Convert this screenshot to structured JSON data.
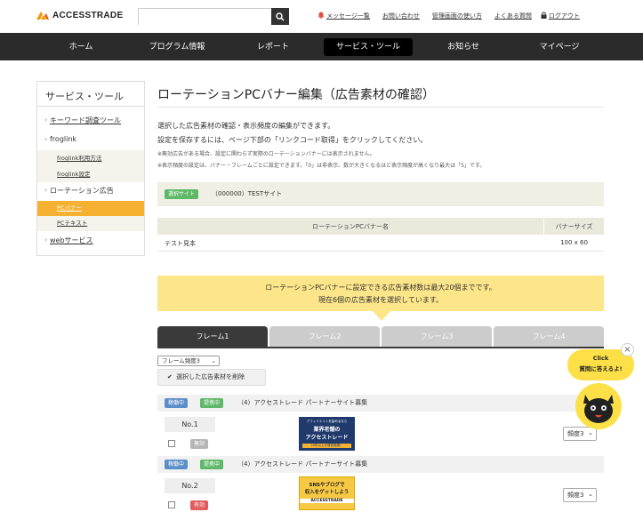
{
  "header": {
    "logo_text": "ACCESSTRADE",
    "search_placeholder": "",
    "links": [
      "メッセージ一覧",
      "お問い合わせ",
      "管理画面の使い方",
      "よくある質問",
      "ログアウト"
    ]
  },
  "nav": {
    "items": [
      "ホーム",
      "プログラム情報",
      "レポート",
      "サービス・ツール",
      "お知らせ",
      "マイページ"
    ],
    "active_index": 3
  },
  "sidebar": {
    "title": "サービス・ツール",
    "items": [
      {
        "label": "キーワード調査ツール"
      },
      {
        "label": "froglink"
      },
      {
        "label": "froglink利用方法"
      },
      {
        "label": "froglink設定"
      },
      {
        "label": "ローテーション広告"
      },
      {
        "label": "PCバナー"
      },
      {
        "label": "PCテキスト"
      },
      {
        "label": "webサービス"
      }
    ]
  },
  "main": {
    "title": "ローテーションPCバナー編集（広告素材の確認）",
    "desc1": "選択した広告素材の確認・表示頻度の編集ができます。",
    "desc2": "設定を保存するには、ページ下部の「リンクコード取得」をクリックしてください。",
    "note1": "※無効広告がある場合、設定に関わらず実際のローテーションバナーには表示されません。",
    "note2": "※表示頻度の設定は、バナー・フレームごとに設定できます。「0」は非表示、数が大きくなるほど表示頻度が高くなり最大は「5」です。",
    "site_tag": "選択サイト",
    "site_name": "（000000）TESTサイト",
    "table_header_name": "ローテーションPCバナー名",
    "table_header_size": "バナーサイズ",
    "table_row_name": "テスト見本",
    "table_row_size": "100 x 60",
    "notice_line1": "ローテーションPCバナーに設定できる広告素材数は最大20個までです。",
    "notice_line2": "現在6個の広告素材を選択しています。",
    "tabs": [
      "フレーム1",
      "フレーム2",
      "フレーム3",
      "フレーム4"
    ],
    "frame_select": "フレーム頻度3",
    "delete_button": "選択した広告素材を削除"
  },
  "items": [
    {
      "status1": "稼働中",
      "status2": "提携中",
      "program": "（4）アクセストレード パートナーサイト募集",
      "number": "No.1",
      "validity": "無効",
      "banner_text": [
        "アフィリエイトを始めるなら",
        "業界老舗の",
        "アクセストレード",
        "20年以上の運営実績！"
      ],
      "priority": "頻度3"
    },
    {
      "status1": "稼働中",
      "status2": "提携中",
      "program": "（4）アクセストレード パートナーサイト募集",
      "number": "No.2",
      "validity": "有効",
      "banner_text": [
        "SNSやブログで",
        "収入をゲットしよう",
        "ACCESSTRADE"
      ],
      "priority": "頻度3"
    }
  ],
  "floating": {
    "bubble_line1": "Click",
    "bubble_line2": "質問に答えるよ!"
  },
  "colors": {
    "accent_orange": "#f7b132",
    "tag_green": "#5fb768",
    "tag_blue": "#5b8ec9",
    "invalid_gray": "#b5b5b5",
    "valid_red": "#e25c5c",
    "notice_yellow": "#fde68a",
    "nav_dark": "#2b2b2b"
  }
}
